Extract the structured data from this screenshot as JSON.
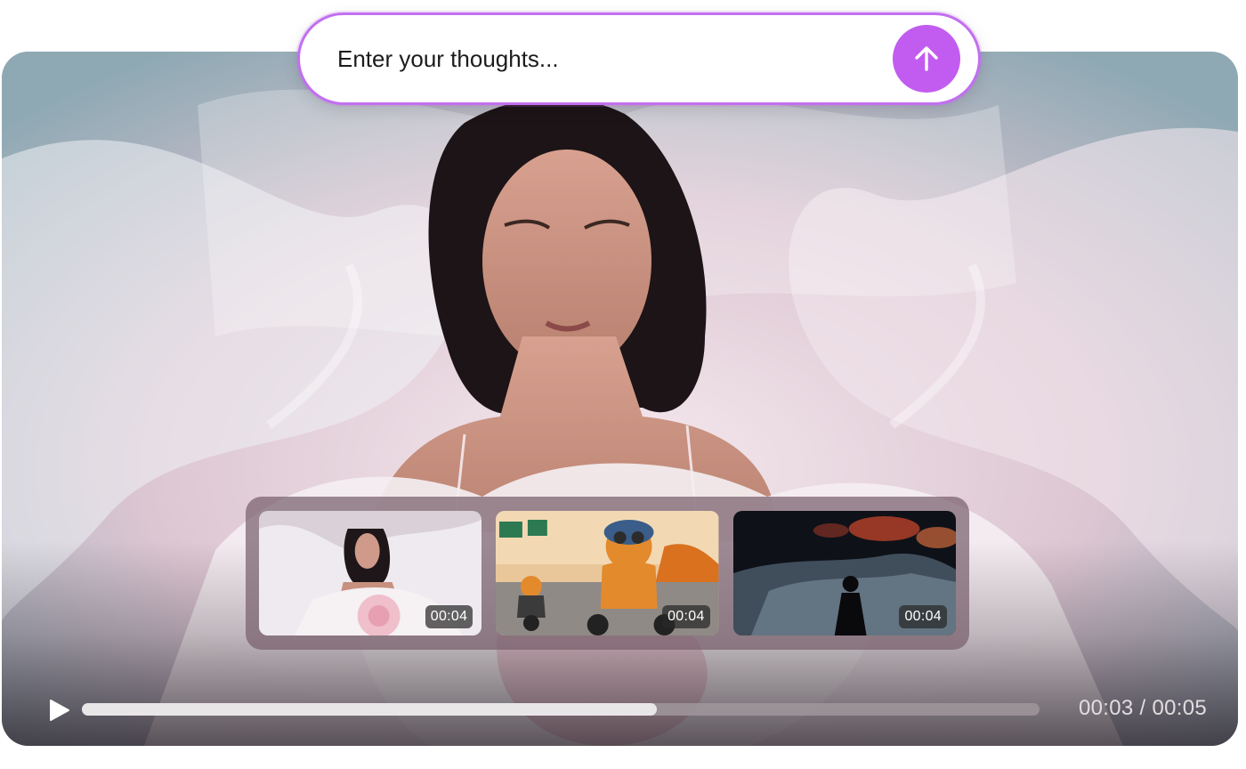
{
  "prompt": {
    "placeholder": "Enter your thoughts...",
    "send_icon": "arrow-up-icon",
    "accent_color": "#c25cf0"
  },
  "video": {
    "current_time": "00:03",
    "separator": "/",
    "total_time": "00:05",
    "progress": 0.6
  },
  "thumbnails": [
    {
      "name": "woman-in-petals",
      "duration": "00:04"
    },
    {
      "name": "cat-on-motorcycle",
      "duration": "00:04"
    },
    {
      "name": "silhouette-smoke",
      "duration": "00:04"
    }
  ],
  "controls": {
    "play_icon": "play-icon"
  }
}
